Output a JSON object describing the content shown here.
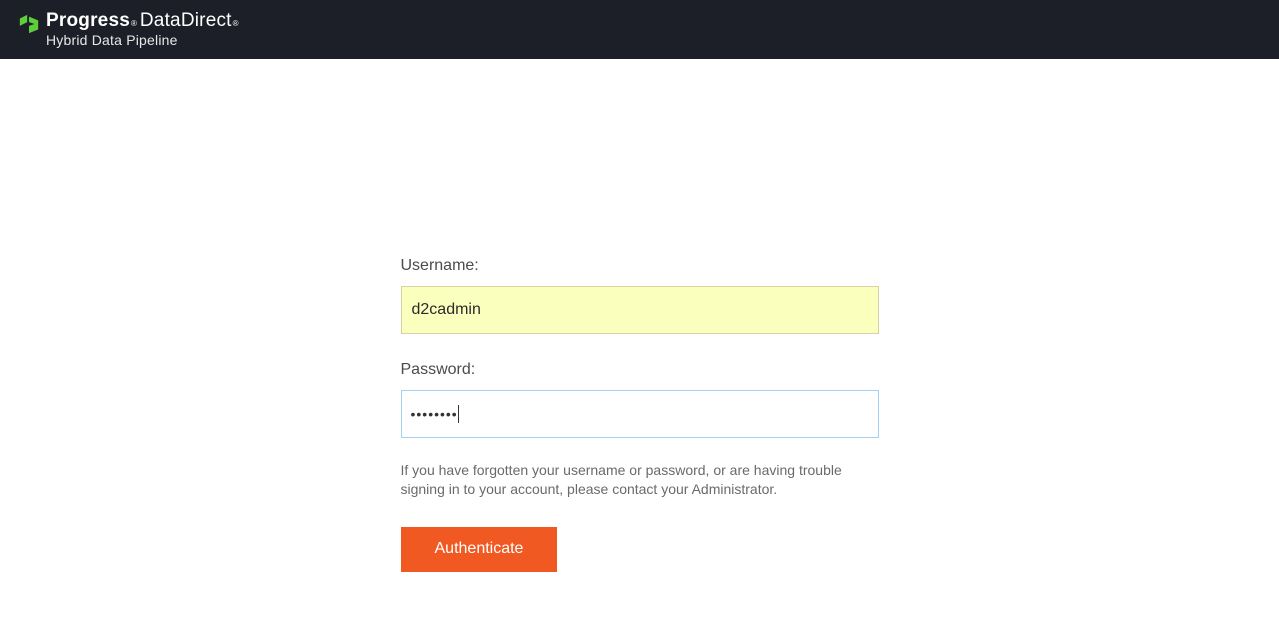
{
  "header": {
    "brand_primary": "Progress",
    "brand_secondary": "DataDirect",
    "brand_subtitle": "Hybrid Data Pipeline"
  },
  "form": {
    "username_label": "Username:",
    "username_value": "d2cadmin",
    "password_label": "Password:",
    "password_value": "••••••••",
    "help_text": "If you have forgotten your username or password, or are having trouble signing in to your account, please contact your Administrator.",
    "submit_label": "Authenticate"
  },
  "colors": {
    "header_bg": "#1c1e28",
    "accent": "#f05a22",
    "logo_green": "#5ece3a",
    "username_bg": "#faffbd"
  }
}
